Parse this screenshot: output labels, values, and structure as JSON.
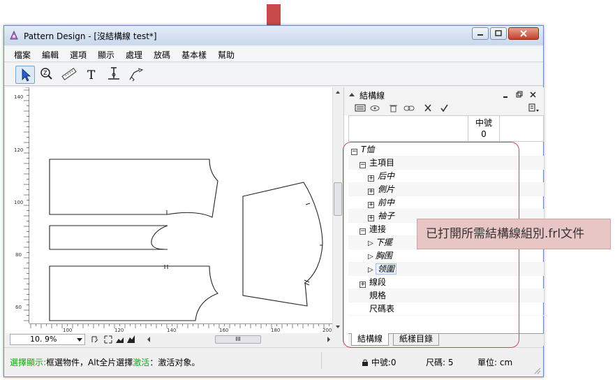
{
  "window": {
    "title": "Pattern Design - [沒結構線 test*]"
  },
  "menu": [
    "檔案",
    "編輯",
    "選項",
    "顯示",
    "處理",
    "放碼",
    "基本樣",
    "幫助"
  ],
  "toolbar": {
    "tools": [
      "select-arrow-icon",
      "zoom-icon",
      "ruler-icon",
      "text-tool-icon",
      "seam-tool-icon",
      "point-tool-icon"
    ],
    "text_tool_glyph": "T"
  },
  "vruler": {
    "labels": [
      "140",
      "120",
      "100",
      "80",
      "60"
    ]
  },
  "hruler": {
    "labels": [
      "100",
      "120",
      "140",
      "160",
      "180",
      "200"
    ]
  },
  "zoom": {
    "value": "10. 9%"
  },
  "hscroll": {
    "thumb_glyph": "III"
  },
  "panel": {
    "title": "結構線",
    "column_header": {
      "size_name": "中號",
      "size_value": "0"
    },
    "tree": [
      {
        "label": "T恤",
        "level": 0,
        "marker": "minus",
        "italic": true
      },
      {
        "label": "主項目",
        "level": 1,
        "marker": "minus",
        "italic": false
      },
      {
        "label": "后中",
        "level": 2,
        "marker": "plus",
        "italic": true
      },
      {
        "label": "側片",
        "level": 2,
        "marker": "plus",
        "italic": true
      },
      {
        "label": "前中",
        "level": 2,
        "marker": "plus",
        "italic": true
      },
      {
        "label": "袖子",
        "level": 2,
        "marker": "plus",
        "italic": true
      },
      {
        "label": "連接",
        "level": 1,
        "marker": "minus",
        "italic": false
      },
      {
        "label": "下擺",
        "level": 2,
        "marker": "triangle",
        "italic": true
      },
      {
        "label": "胸围",
        "level": 2,
        "marker": "triangle",
        "italic": true
      },
      {
        "label": "领圍",
        "level": 2,
        "marker": "triangle",
        "italic": true,
        "selected": true
      },
      {
        "label": "線段",
        "level": 1,
        "marker": "plus",
        "italic": false
      },
      {
        "label": "規格",
        "level": 1,
        "marker": "none",
        "italic": false
      },
      {
        "label": "尺碼表",
        "level": 1,
        "marker": "none",
        "italic": false
      }
    ],
    "tabs": [
      "結構線",
      "紙樣目錄"
    ]
  },
  "status": {
    "left_green_1": "選擇顯示:",
    "left_text_1": "框選物件，Alt全片選擇",
    "left_green_2": "激活",
    "left_text_2": "：激活对象。",
    "size_label": "中號:0",
    "sizes_label": "尺碼: 5",
    "unit_label": "單位: cm"
  },
  "callout": {
    "text": "已打開所需結構線組別.frl文件"
  },
  "colors": {
    "arrow": "#c94a4a",
    "outline": "#d0445a",
    "callout_bg": "#e9c6c6",
    "status_green": "#1aa31a"
  }
}
